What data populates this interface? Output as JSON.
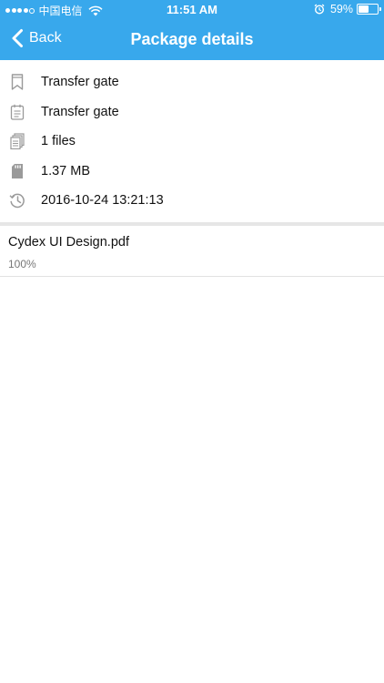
{
  "status_bar": {
    "carrier": "中国电信",
    "time": "11:51 AM",
    "battery_percent": "59%",
    "battery_level": 0.59,
    "signal_bars": 4
  },
  "nav": {
    "back_label": "Back",
    "title": "Package details"
  },
  "details": [
    {
      "icon": "bookmark-icon",
      "text": "Transfer gate"
    },
    {
      "icon": "note-icon",
      "text": "Transfer gate"
    },
    {
      "icon": "files-icon",
      "text": "1 files"
    },
    {
      "icon": "sd-card-icon",
      "text": "1.37 MB"
    },
    {
      "icon": "history-icon",
      "text": "2016-10-24 13:21:13"
    }
  ],
  "files": [
    {
      "name": "Cydex UI Design.pdf",
      "progress": "100%"
    }
  ],
  "colors": {
    "accent": "#38a8ec",
    "icon_gray": "#9a9a9a",
    "separator": "#e6e6e6"
  }
}
